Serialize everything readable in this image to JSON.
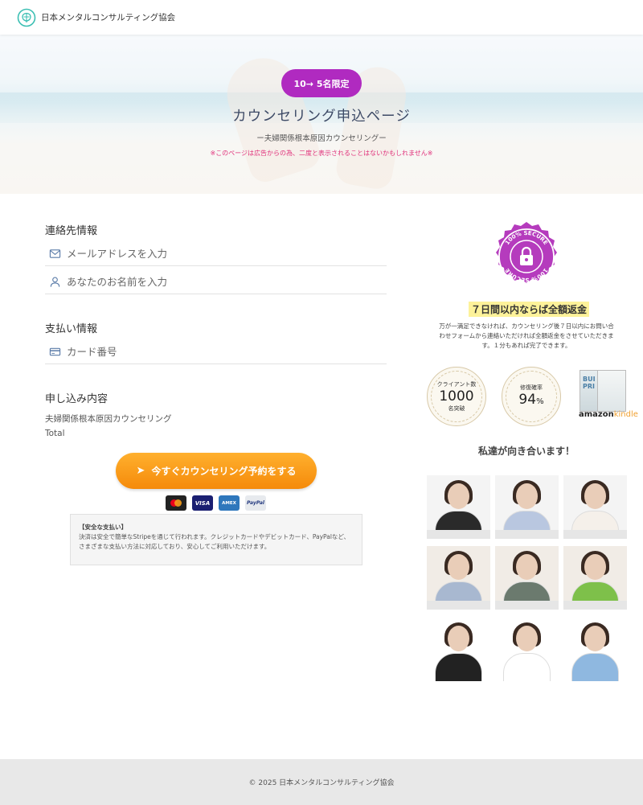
{
  "header": {
    "logo_icon": "brain-logo-icon",
    "brand": "日本メンタルコンサルティング協会"
  },
  "hero": {
    "badge": "10→ 5名限定",
    "title": "カウンセリング申込ページ",
    "subtitle": "ー夫婦関係根本原因カウンセリングー",
    "notice": "※このページは広告からの為、二度と表示されることはないかもしれません※"
  },
  "form": {
    "contact": {
      "title": "連絡先情報",
      "email_placeholder": "メールアドレスを入力",
      "name_placeholder": "あなたのお名前を入力"
    },
    "payment": {
      "title": "支払い情報",
      "card_placeholder": "カード番号"
    },
    "order": {
      "title": "申し込み内容",
      "item": "夫婦関係根本原因カウンセリング",
      "total_label": "Total"
    },
    "cta_label": "今すぐカウンセリング予約をする",
    "payment_cards": [
      "Mastercard",
      "VISA",
      "AMEX",
      "PayPal"
    ],
    "secure_box": {
      "title": "【安全な支払い】",
      "body": "決済は安全で簡単なStripeを通じて行われます。クレジットカードやデビットカード、PayPalなど、さまざまな支払い方法に対応しており、安心してご利用いただけます。"
    }
  },
  "sidebar": {
    "seal_text": "100% SECURE",
    "refund_title": "７日間以内ならば全額返金",
    "refund_text": "万が一満足できなければ、カウンセリング後７日以内にお問い合わせフォームから連絡いただければ全額返金をさせていただきます。１分もあれば完了できます。",
    "stats": [
      {
        "label": "クライアント数",
        "value": "1000",
        "unit": "",
        "sub": "名突破"
      },
      {
        "label": "修復確率",
        "value": "94",
        "unit": "%",
        "sub": ""
      }
    ],
    "book_title": "BUI PRI",
    "amazon": "amazon",
    "kindle": "kindle",
    "team_title": "私達が向き合います！",
    "team": [
      {
        "shirt": "#2a2a2a",
        "bg": "#f4f4f4"
      },
      {
        "shirt": "#b9c7e0",
        "bg": "#f4f4f4"
      },
      {
        "shirt": "#f5f0ea",
        "bg": "#f4f4f4"
      },
      {
        "shirt": "#a8b8d0",
        "bg": "#f1ece6"
      },
      {
        "shirt": "#6b7a6e",
        "bg": "#f1ece6"
      },
      {
        "shirt": "#7ec04a",
        "bg": "#f1ece6"
      },
      {
        "shirt": "#222222",
        "bg": "#ffffff"
      },
      {
        "shirt": "#ffffff",
        "bg": "#ffffff"
      },
      {
        "shirt": "#8fb8e0",
        "bg": "#ffffff"
      }
    ]
  },
  "footer": {
    "copyright": "© 2025 日本メンタルコンサルティング協会"
  }
}
